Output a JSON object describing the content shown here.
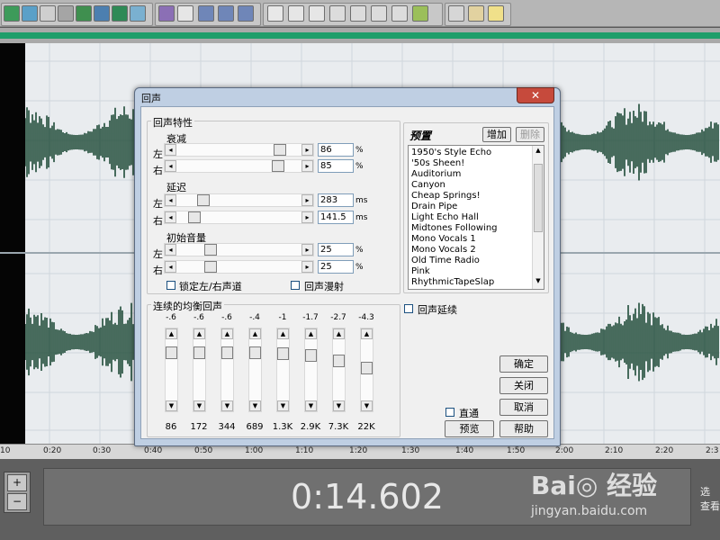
{
  "timeline": {
    "ticks": [
      "10",
      "0:20",
      "0:30",
      "0:40",
      "0:50",
      "1:00",
      "1:10",
      "1:20",
      "1:30",
      "1:40",
      "1:50",
      "2:00",
      "2:10",
      "2:20",
      "2:3"
    ]
  },
  "time_display": "0:14.602",
  "watermark": {
    "brand": "Bai◎ 经验",
    "url": "jingyan.baidu.com"
  },
  "right_panel": {
    "line1": "选",
    "line2": "查看"
  },
  "zoom": {
    "in": "+",
    "out": "−"
  },
  "dialog": {
    "title": "回声",
    "close_label": "✕",
    "echo_props": {
      "group_label": "回声特性",
      "decay": {
        "label": "衰减",
        "left_label": "左",
        "right_label": "右",
        "left_value": "86",
        "right_value": "85",
        "unit": "%",
        "left_level": 0.86,
        "right_level": 0.85
      },
      "delay": {
        "label": "延迟",
        "left_label": "左",
        "right_label": "右",
        "left_value": "283",
        "right_value": "141.5",
        "unit": "ms",
        "left_level": 0.18,
        "right_level": 0.1
      },
      "initial_volume": {
        "label": "初始音量",
        "left_label": "左",
        "right_label": "右",
        "left_value": "25",
        "right_value": "25",
        "unit": "%",
        "left_level": 0.25,
        "right_level": 0.25
      },
      "lock_label": "锁定左/右声道",
      "diffusion_label": "回声漫射"
    },
    "presets": {
      "title": "预置",
      "add_label": "增加",
      "delete_label": "删除",
      "items": [
        "1950's Style Echo",
        "'50s Sheen!",
        "Auditorium",
        "Canyon",
        "Cheap Springs!",
        "Drain Pipe",
        "Light Echo Hall",
        "Midtones Following",
        "Mono Vocals 1",
        "Mono Vocals 2",
        "Old Time Radio",
        "Pink",
        "RhythmicTapeSlap"
      ]
    },
    "continue_echo_label": "回声延续",
    "eq": {
      "group_label": "连续的均衡回声",
      "bands": [
        {
          "value": "-.6",
          "freq": "86",
          "level": 0.1
        },
        {
          "value": "-.6",
          "freq": "172",
          "level": 0.1
        },
        {
          "value": "-.6",
          "freq": "344",
          "level": 0.1
        },
        {
          "value": "-.4",
          "freq": "689",
          "level": 0.1
        },
        {
          "value": "-1",
          "freq": "1.3K",
          "level": 0.12
        },
        {
          "value": "-1.7",
          "freq": "2.9K",
          "level": 0.15
        },
        {
          "value": "-2.7",
          "freq": "7.3K",
          "level": 0.24
        },
        {
          "value": "-4.3",
          "freq": "22K",
          "level": 0.36
        }
      ]
    },
    "buttons": {
      "ok": "确定",
      "close": "关闭",
      "cancel": "取消",
      "help": "帮助",
      "preview": "预览"
    },
    "bypass_label": "直通"
  },
  "colors": {
    "waveform": "#1f4b38",
    "overview": "#1e9e6a",
    "dialog_frame": "#bfcfe3",
    "close_button": "#c64a3c"
  }
}
